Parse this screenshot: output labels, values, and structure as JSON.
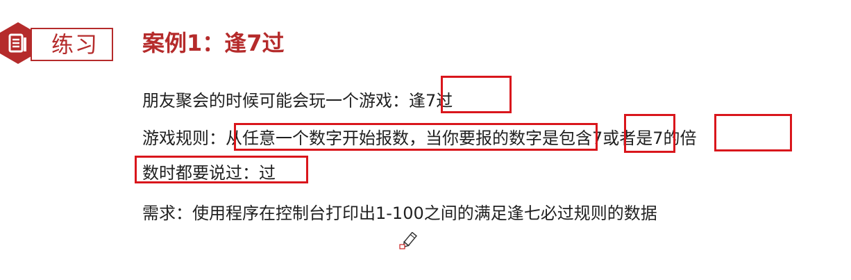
{
  "badge": {
    "label": "练习",
    "icon": "document-list-icon",
    "color": "#b52b2b"
  },
  "title": "案例1：逢7过",
  "paragraph": {
    "line1": "朋友聚会的时候可能会玩一个游戏：逢7过",
    "line2": "游戏规则：从任意一个数字开始报数，当你要报的数字是包含7或者是7的倍",
    "line3": "数时都要说过：过",
    "line4": "需求：使用程序在控制台打印出1-100之间的满足逢七必过规则的数据"
  },
  "highlight_color": "#d9161c",
  "cursor": "pencil-cursor-icon"
}
